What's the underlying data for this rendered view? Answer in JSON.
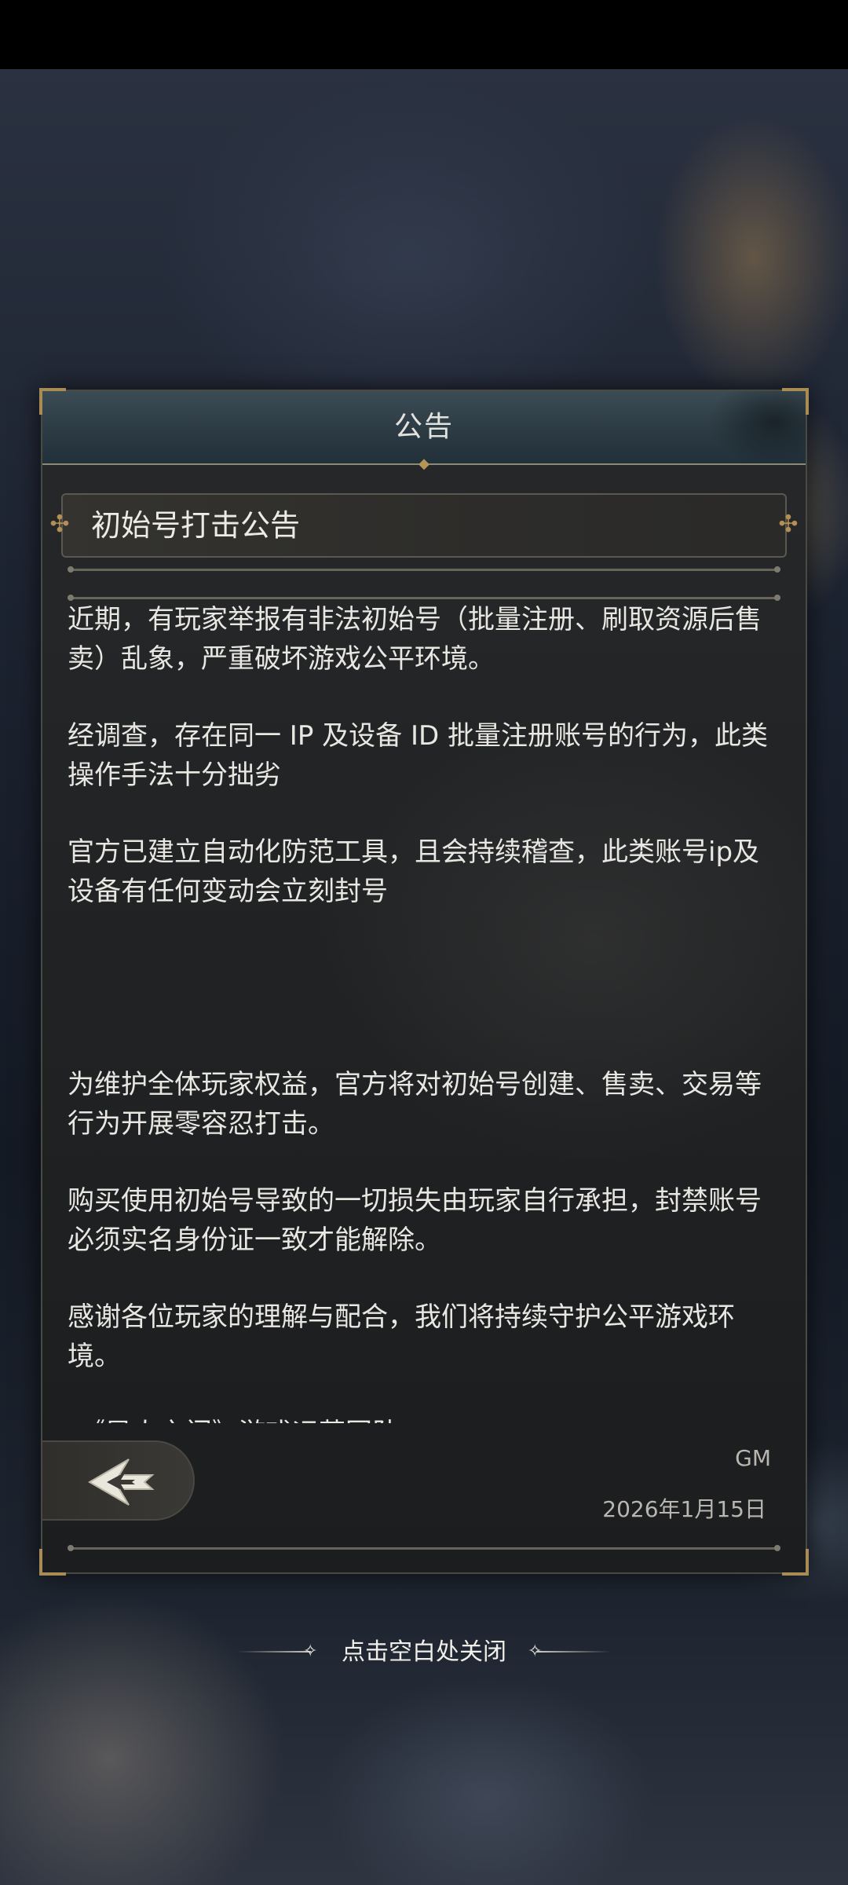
{
  "dialog": {
    "title": "公告",
    "subtitle": "初始号打击公告",
    "paragraphs_top": [
      "近期，有玩家举报有非法初始号（批量注册、刷取资源后售卖）乱象，严重破坏游戏公平环境。",
      "经调查，存在同一 IP 及设备 ID 批量注册账号的行为，此类操作手法十分拙劣",
      "官方已建立自动化防范工具，且会持续稽查，此类账号ip及设备有任何变动会立刻封号"
    ],
    "paragraphs_bottom": [
      "为维护全体玩家权益，官方将对初始号创建、售卖、交易等行为开展零容忍打击。",
      "购买使用初始号导致的一切损失由玩家自行承担，封禁账号必须实名身份证一致才能解除。",
      "感谢各位玩家的理解与配合，我们将持续守护公平游戏环境。"
    ],
    "cut_off_line": "《异人之门》游戏运营团队",
    "signature": "GM",
    "date": "2026年1月15日"
  },
  "close_hint": "点击空白处关闭",
  "colors": {
    "accent_gold": "#b48f55",
    "panel_bg": "#202224",
    "title_bar": "#2b3a42"
  }
}
